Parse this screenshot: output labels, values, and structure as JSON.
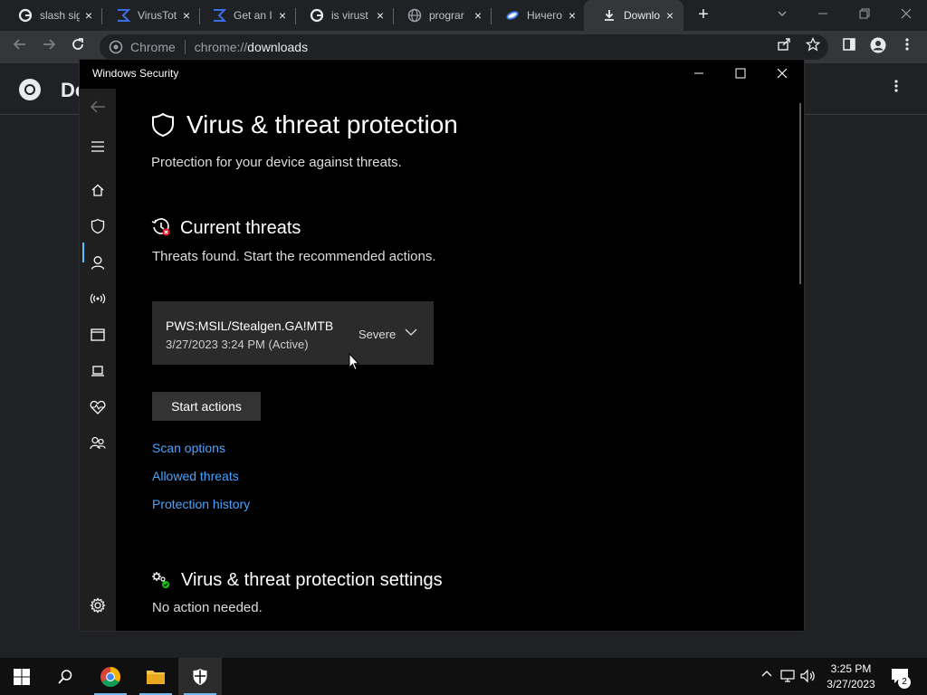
{
  "browser": {
    "tabs": [
      {
        "title": "slash sig",
        "icon": "google-icon"
      },
      {
        "title": "VirusTot",
        "icon": "virustotal-icon"
      },
      {
        "title": "Get an I",
        "icon": "virustotal-icon"
      },
      {
        "title": "is virust",
        "icon": "google-icon"
      },
      {
        "title": "prograr",
        "icon": "globe-icon"
      },
      {
        "title": "Ничего",
        "icon": "site-icon"
      },
      {
        "title": "Downlo",
        "icon": "download-icon"
      }
    ],
    "tab_close": "×",
    "new_tab": "+",
    "omnibox": {
      "host": "Chrome",
      "scheme": "chrome://",
      "path": "downloads"
    },
    "page_title": "Do"
  },
  "windows_security": {
    "window_title": "Windows Security",
    "heading": "Virus & threat protection",
    "heading_sub": "Protection for your device against threats.",
    "current_threats": {
      "title": "Current threats",
      "status": "Threats found. Start the recommended actions.",
      "threat": {
        "name": "PWS:MSIL/Stealgen.GA!MTB",
        "date": "3/27/2023 3:24 PM (Active)",
        "severity": "Severe"
      },
      "start_button": "Start actions"
    },
    "links": {
      "scan_options": "Scan options",
      "allowed_threats": "Allowed threats",
      "protection_history": "Protection history"
    },
    "settings": {
      "title": "Virus & threat protection settings",
      "status": "No action needed."
    }
  },
  "taskbar": {
    "time": "3:25 PM",
    "date": "3/27/2023",
    "notification_count": "2"
  },
  "colors": {
    "link": "#4aa3ff",
    "accent": "#76b9ed",
    "severity_dot": "#e81123",
    "ok_dot": "#16c60c"
  }
}
